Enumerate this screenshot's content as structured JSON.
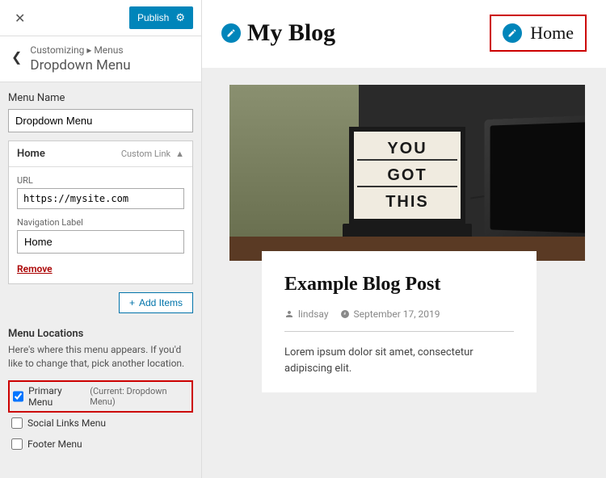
{
  "sidebar": {
    "publish_label": "Publish",
    "breadcrumb": "Customizing ▸ Menus",
    "page_title": "Dropdown Menu",
    "menu_name_label": "Menu Name",
    "menu_name_value": "Dropdown Menu",
    "menu_item": {
      "name": "Home",
      "type": "Custom Link",
      "url_label": "URL",
      "url_value": "https://mysite.com",
      "nav_label_label": "Navigation Label",
      "nav_label_value": "Home",
      "remove_label": "Remove"
    },
    "add_items_label": "Add Items",
    "locations": {
      "heading": "Menu Locations",
      "desc": "Here's where this menu appears. If you'd like to change that, pick another location.",
      "items": [
        {
          "label": "Primary Menu",
          "current": "(Current: Dropdown Menu)",
          "checked": true,
          "highlight": true
        },
        {
          "label": "Social Links Menu",
          "current": "",
          "checked": false,
          "highlight": false
        },
        {
          "label": "Footer Menu",
          "current": "",
          "checked": false,
          "highlight": false
        }
      ]
    }
  },
  "preview": {
    "site_title": "My Blog",
    "nav_item": "Home",
    "lightbox": {
      "l1": "YOU",
      "l2": "GOT",
      "l3": "THIS"
    },
    "post": {
      "title": "Example Blog Post",
      "author": "lindsay",
      "date": "September 17, 2019",
      "excerpt": "Lorem ipsum dolor sit amet, consectetur adipiscing elit."
    }
  }
}
